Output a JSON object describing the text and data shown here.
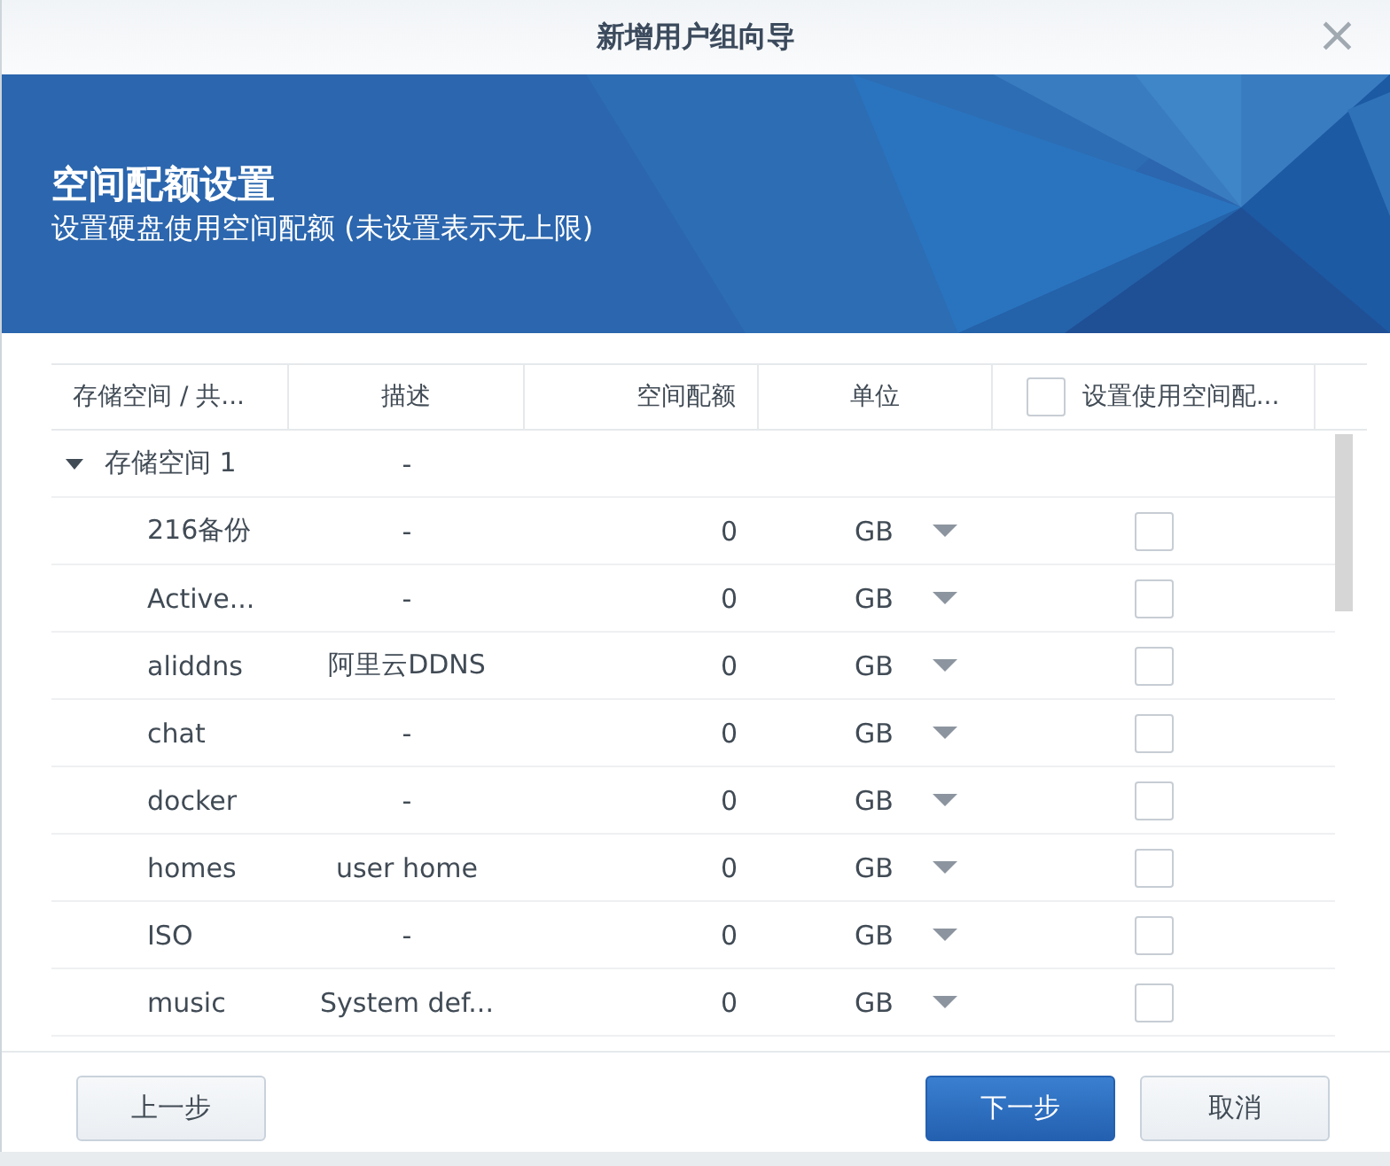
{
  "window": {
    "title": "新增用户组向导",
    "close": "×"
  },
  "banner": {
    "title": "空间配额设置",
    "subtitle": "设置硬盘使用空间配额 (未设置表示无上限)"
  },
  "table": {
    "columns": [
      {
        "label": "存储空间 / 共..."
      },
      {
        "label": "描述"
      },
      {
        "label": "空间配额"
      },
      {
        "label": "单位"
      },
      {
        "label": "设置使用空间配...",
        "checked": false
      }
    ],
    "group": {
      "name": "存储空间 1",
      "description": "-",
      "expanded": true
    },
    "rows": [
      {
        "name": "216备份",
        "description": "-",
        "quota": "0",
        "unit": "GB",
        "checked": false
      },
      {
        "name": "Active...",
        "description": "-",
        "quota": "0",
        "unit": "GB",
        "checked": false
      },
      {
        "name": "aliddns",
        "description": "阿里云DDNS",
        "quota": "0",
        "unit": "GB",
        "checked": false
      },
      {
        "name": "chat",
        "description": "-",
        "quota": "0",
        "unit": "GB",
        "checked": false
      },
      {
        "name": "docker",
        "description": "-",
        "quota": "0",
        "unit": "GB",
        "checked": false
      },
      {
        "name": "homes",
        "description": "user home",
        "quota": "0",
        "unit": "GB",
        "checked": false
      },
      {
        "name": "ISO",
        "description": "-",
        "quota": "0",
        "unit": "GB",
        "checked": false
      },
      {
        "name": "music",
        "description": "System def...",
        "quota": "0",
        "unit": "GB",
        "checked": false
      }
    ]
  },
  "buttons": [
    {
      "label": "上一步",
      "kind": "secondary"
    },
    {
      "label": "下一步",
      "kind": "primary"
    },
    {
      "label": "取消",
      "kind": "secondary"
    }
  ]
}
